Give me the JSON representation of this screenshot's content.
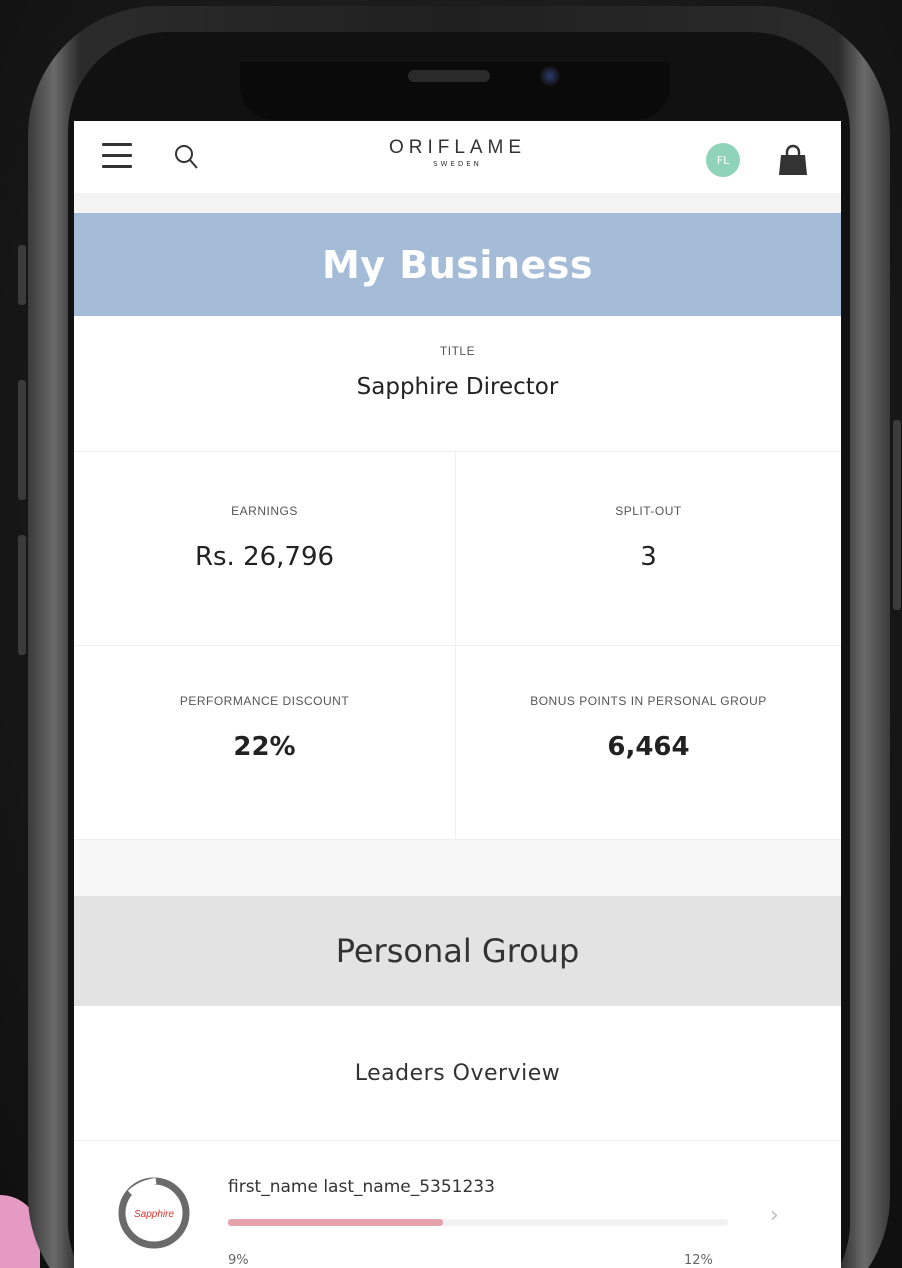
{
  "header": {
    "logo_main": "ORIFLAME",
    "logo_sub": "SWEDEN",
    "avatar_initials": "FL",
    "avatar_color": "#8fd3ba"
  },
  "banner": {
    "title": "My Business",
    "color": "#a5bcd8"
  },
  "title_block": {
    "label": "TITLE",
    "value": "Sapphire Director"
  },
  "stats": [
    {
      "label": "EARNINGS",
      "value": "Rs. 26,796"
    },
    {
      "label": "SPLIT-OUT",
      "value": "3"
    },
    {
      "label": "PERFORMANCE DISCOUNT",
      "value": "22%"
    },
    {
      "label": "BONUS POINTS IN PERSONAL GROUP",
      "value": "6,464"
    }
  ],
  "personal_group": {
    "title": "Personal Group",
    "subtitle": "Leaders Overview"
  },
  "leaders": [
    {
      "name": "first_name last_name_5351233",
      "badge_text": "Sapphire",
      "progress_fraction": 0.43,
      "progress_color": "#e6a3ae",
      "left_label": "9%",
      "right_label": "12%"
    }
  ]
}
